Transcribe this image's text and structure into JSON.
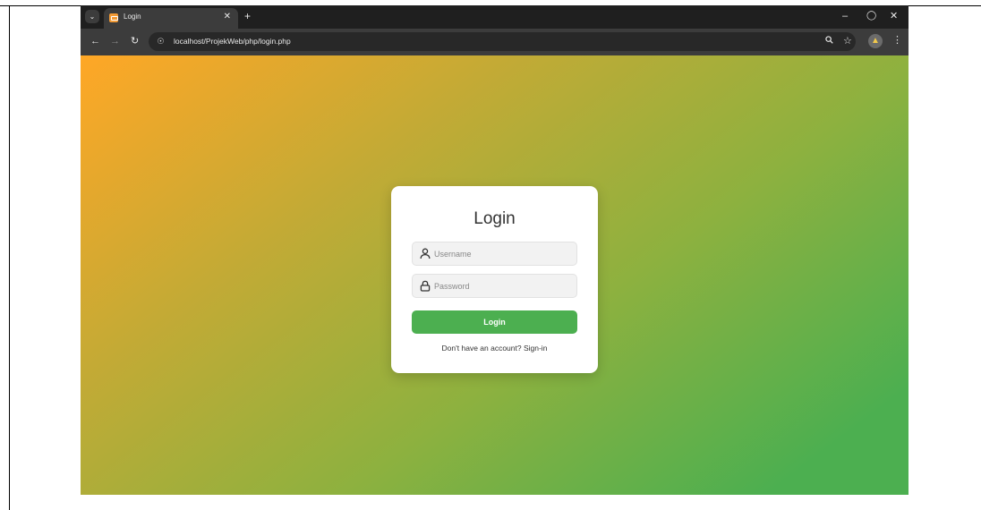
{
  "browser": {
    "tab_menu_icon": "chevron-down-icon",
    "tab": {
      "title": "Login",
      "favicon": "xampp-icon",
      "close_icon": "close-icon"
    },
    "new_tab_icon": "plus-icon",
    "window_controls": [
      "minimize-icon",
      "restore-icon",
      "close-icon"
    ],
    "nav": [
      "back-icon",
      "forward-icon",
      "reload-icon"
    ],
    "url": "localhost/ProjekWeb/php/login.php",
    "omnibox_icons": [
      "site-info-icon",
      "zoom-icon",
      "star-icon"
    ],
    "profile_icon": "profile-avatar-icon",
    "menu_icon": "kebab-menu-icon"
  },
  "page": {
    "background_colors": [
      "#ffa726",
      "#4caf50"
    ],
    "login_card": {
      "title": "Login",
      "username_placeholder": "Username",
      "password_placeholder": "Password",
      "submit_label": "Login",
      "signup_prompt": "Don't have an account?",
      "signup_link": "Sign-in",
      "button_color": "#4caf50"
    }
  }
}
